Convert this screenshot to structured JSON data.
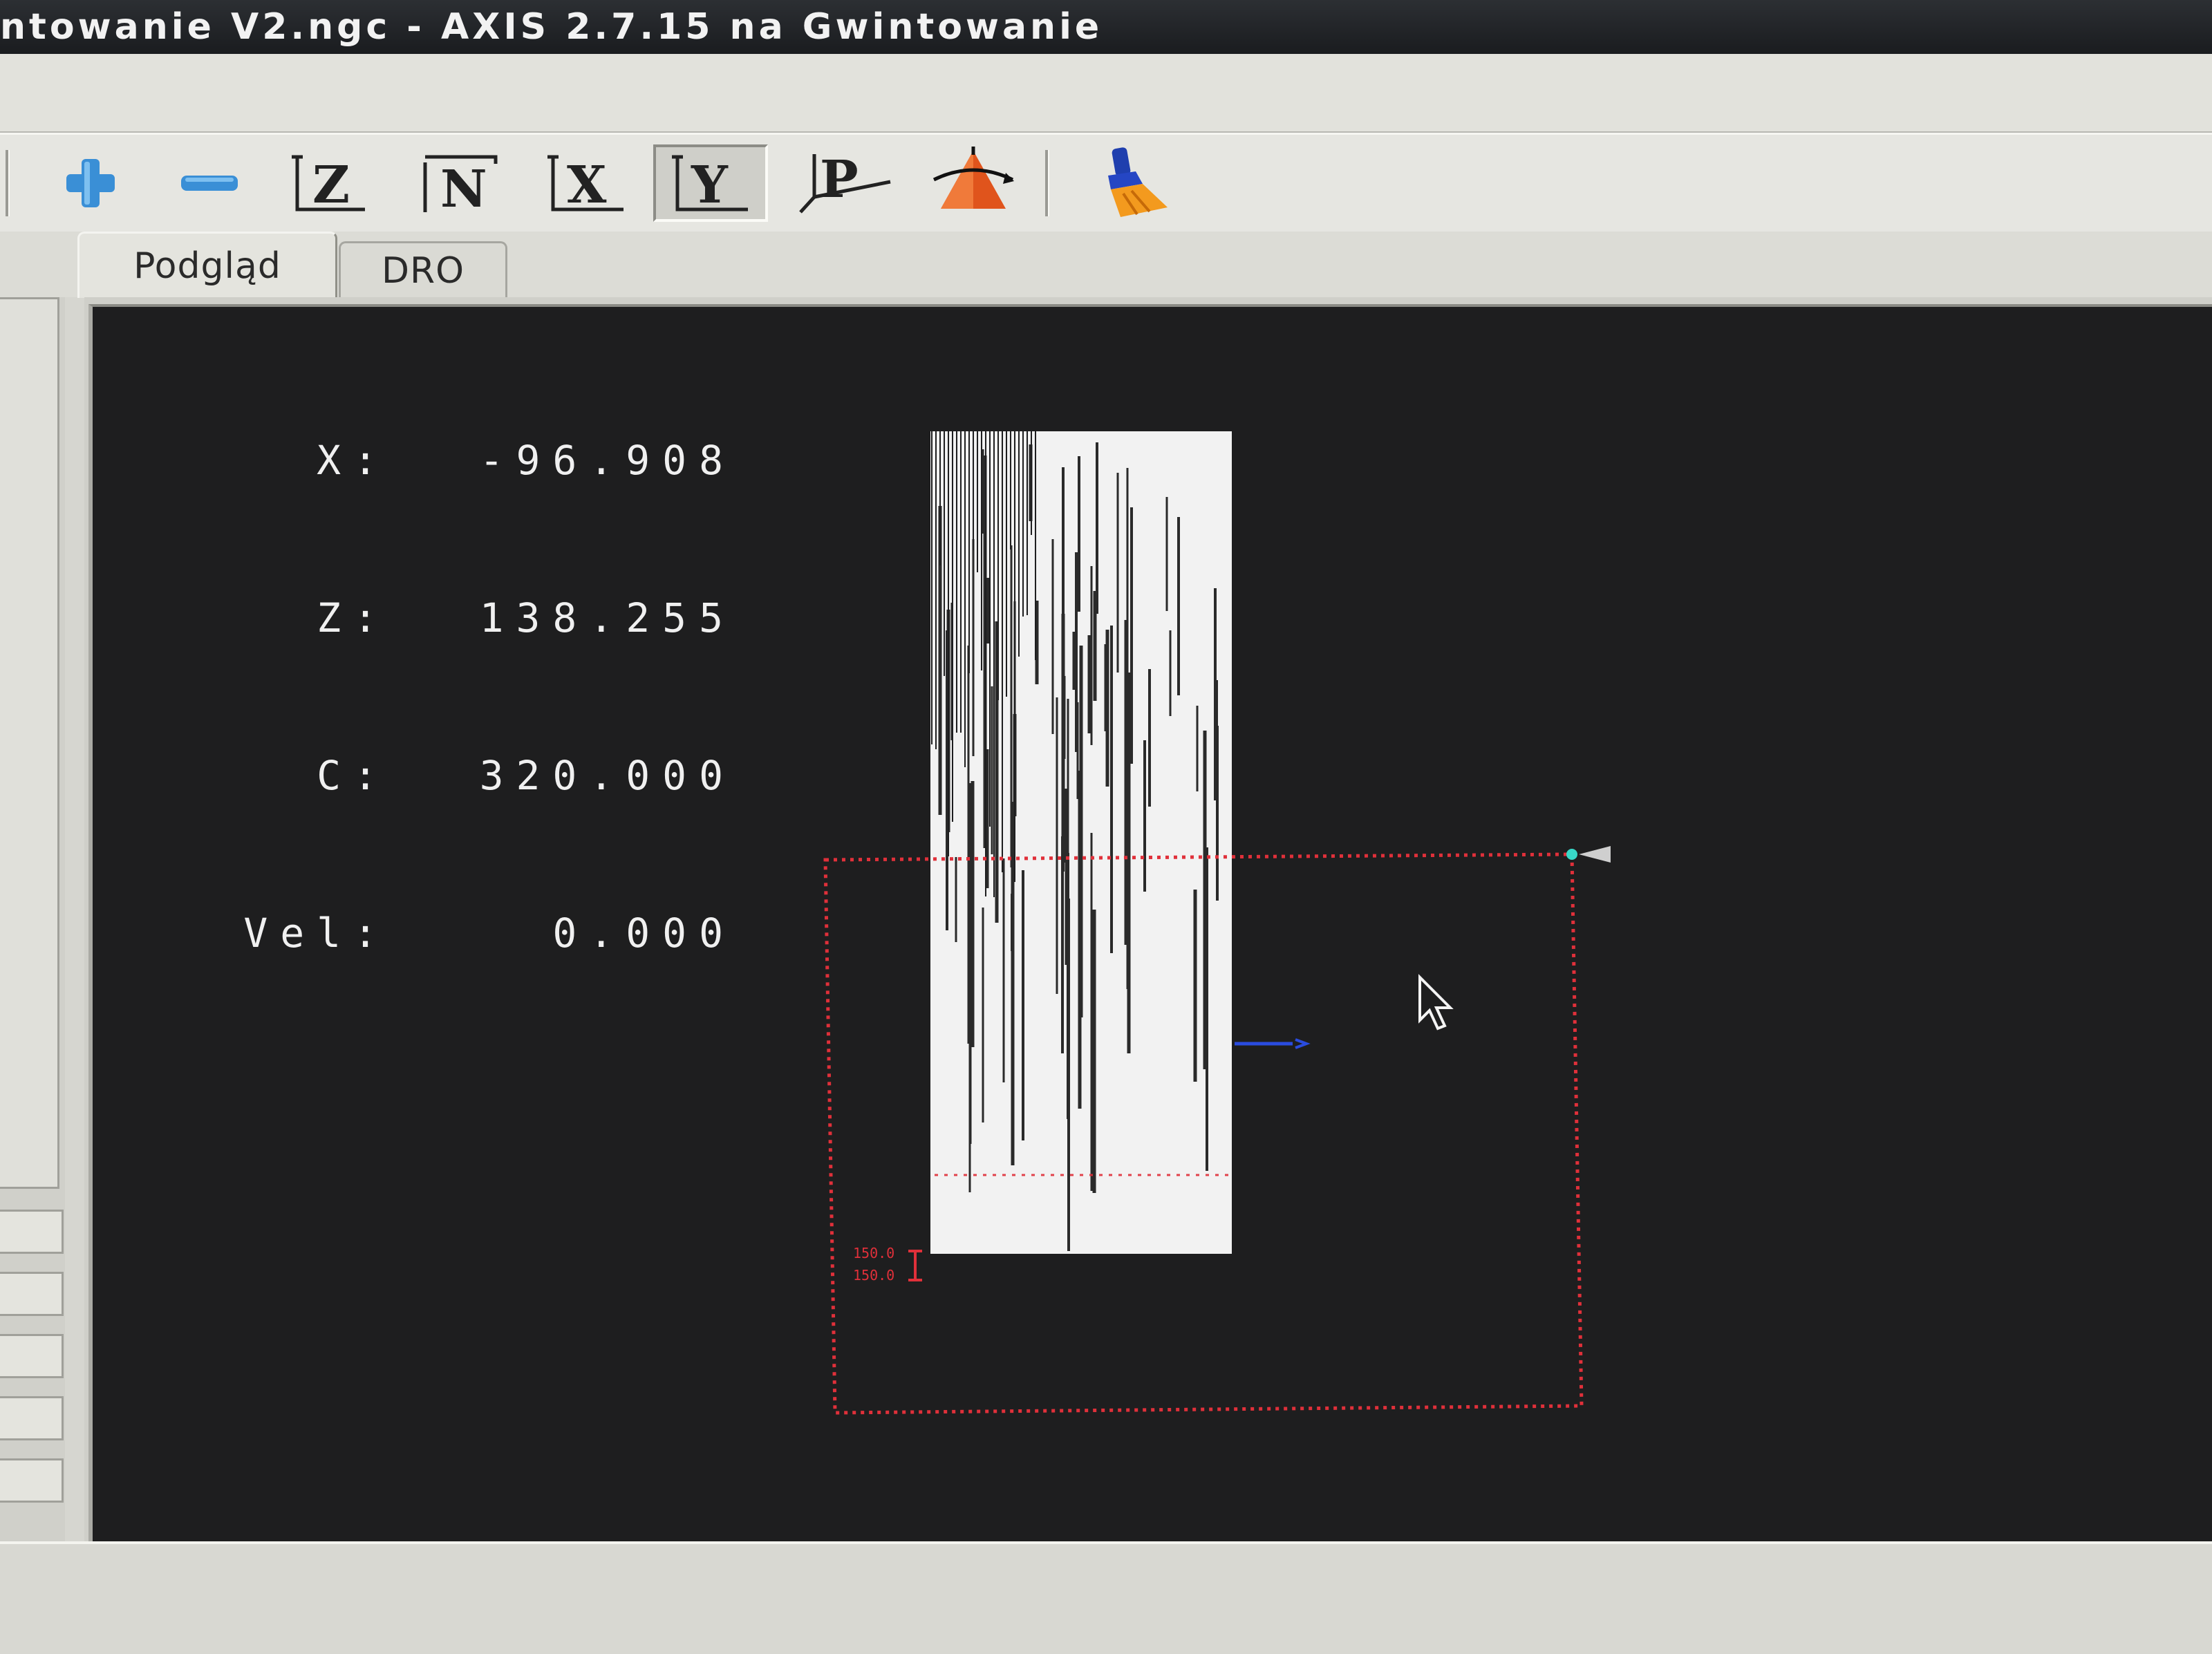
{
  "window": {
    "title": "ntowanie V2.ngc - AXIS 2.7.15 na Gwintowanie"
  },
  "toolbar": {
    "buttons": [
      {
        "icon": "zoom-in-icon",
        "color": "#3a8fd6"
      },
      {
        "icon": "zoom-out-icon",
        "color": "#3a8fd6"
      },
      {
        "icon": "view-z-icon",
        "label": "Z"
      },
      {
        "icon": "view-z2-icon",
        "label": "N"
      },
      {
        "icon": "view-x-icon",
        "label": "X"
      },
      {
        "icon": "view-y-icon",
        "label": "Y",
        "active": true
      },
      {
        "icon": "view-p-icon",
        "label": "P"
      },
      {
        "icon": "rotate-view-icon",
        "color": "#e0541c"
      },
      {
        "icon": "clear-live-plot-icon",
        "color": "#f0a020"
      }
    ]
  },
  "tabs": [
    {
      "label": "Podgląd",
      "active": true
    },
    {
      "label": "DRO",
      "active": false
    }
  ],
  "dro": {
    "rows": [
      {
        "label": "X:",
        "value": "-96.908"
      },
      {
        "label": "Z:",
        "value": "138.255"
      },
      {
        "label": "C:",
        "value": "320.000"
      },
      {
        "label": "Vel:",
        "value": "0.000"
      }
    ]
  },
  "preview": {
    "background": "#1e1e1f",
    "toolpath_color": "#f4f4f4",
    "limits_color": "#e0303a",
    "origin_label_lines": [
      "150.0",
      "150.0"
    ]
  }
}
